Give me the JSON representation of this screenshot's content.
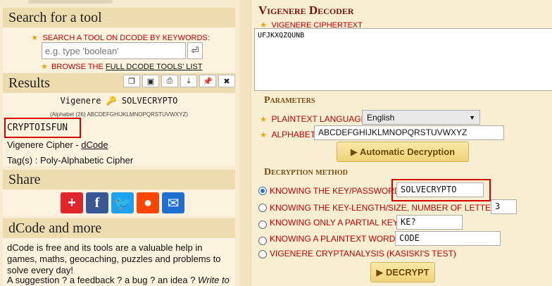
{
  "search": {
    "title": "Search for a tool",
    "keywords_label": "Search a tool on dCode by keywords:",
    "placeholder": "e.g. type 'boolean'",
    "browse_prefix": "Browse the",
    "browse_link": "full dCode tools' list"
  },
  "results": {
    "title": "Results",
    "cipher_line": "Vigenere 🔑 SOLVECRYPTO",
    "alphabet_line": "(Alphabet (26) ABCDEFGHIJKLMNOPQRSTUVWXYZ)",
    "plaintext": "CRYPTOISFUN",
    "cipher_prefix": "Vigenere Cipher - ",
    "cipher_link": "dCode",
    "tags": "Tag(s) : Poly-Alphabetic Cipher",
    "toolbar_icons": [
      "copy-icon",
      "save-icon",
      "print-icon",
      "download-icon",
      "pin-icon",
      "close-icon"
    ]
  },
  "share": {
    "title": "Share",
    "buttons": [
      {
        "name": "addthis-share",
        "glyph": "+",
        "color": "#e0262b"
      },
      {
        "name": "facebook-share",
        "glyph": "f",
        "color": "#3a5795"
      },
      {
        "name": "twitter-share",
        "glyph": "t",
        "color": "#1da1f2"
      },
      {
        "name": "reddit-share",
        "glyph": "r",
        "color": "#ff4500"
      },
      {
        "name": "email-share",
        "glyph": "✉",
        "color": "#1e6fd0"
      }
    ]
  },
  "more": {
    "title": "dCode and more",
    "text1": "dCode is free and its tools are a valuable help in games, maths, geocaching, puzzles and problems to solve every day!",
    "text2_prefix": "A suggestion ? a feedback ? a bug ? an idea ? ",
    "text2_link": "Write to"
  },
  "decoder": {
    "title": "Vigenere Decoder",
    "ciphertext_label": "Vigenere ciphertext",
    "ciphertext": "UFJKXQZQUNB",
    "params_title": "Parameters",
    "plaintext_language_label": "Plaintext Language",
    "language": "English",
    "alphabet_label": "Alphabet",
    "alphabet": "ABCDEFGHIJKLMNOPQRSTUVWXYZ",
    "auto_btn": "▶ Automatic Decryption",
    "method_title": "Decryption method",
    "opt_key_label": "Knowing the Key/Password:",
    "opt_key_value": "SOLVECRYPTO",
    "opt_length_label": "Knowing the key-length/size, number of letters:",
    "opt_length_value": "3",
    "opt_partial_label": "Knowing only a partial key:",
    "opt_partial_value": "KE?",
    "opt_plain_label": "Knowing a plaintext word:",
    "opt_plain_value": "CODE",
    "opt_kasiski_label": "Vigenere cryptanalysis (Kasiski's test)",
    "decrypt_btn": "▶ DECRYPT"
  }
}
